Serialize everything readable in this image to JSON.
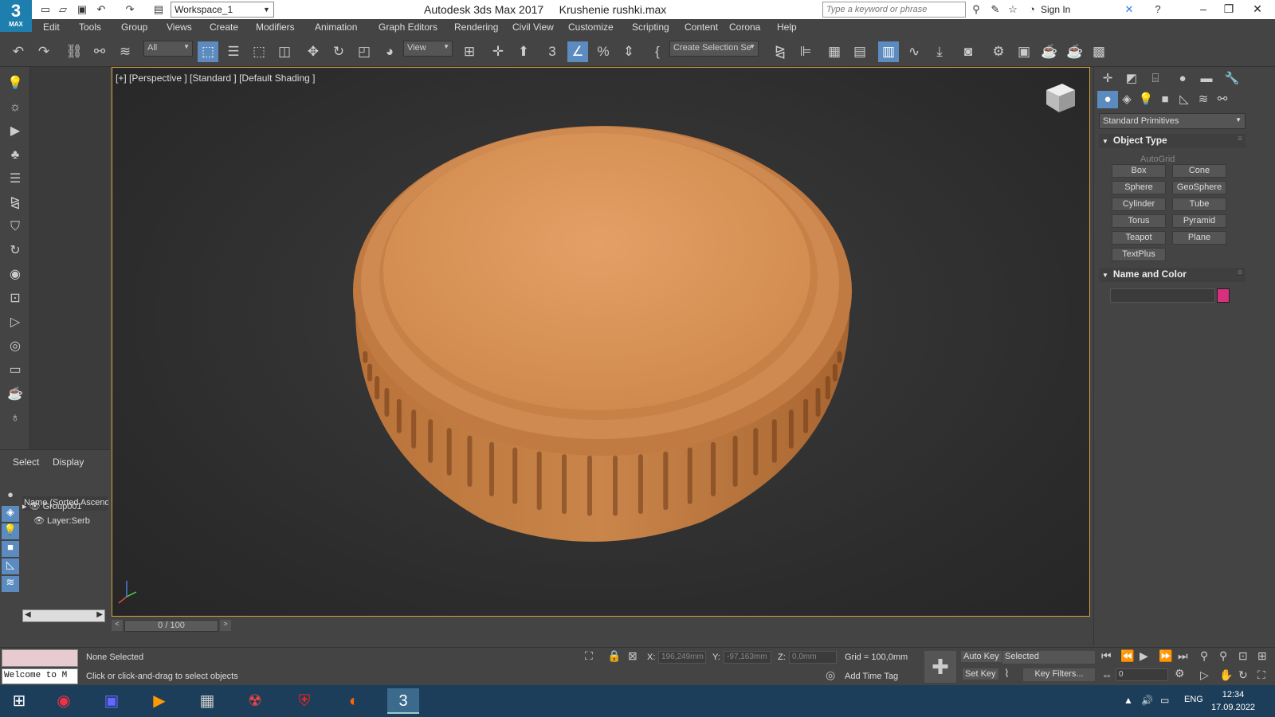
{
  "titlebar": {
    "logo_big": "3",
    "logo_small": "MAX",
    "workspace": "Workspace_1",
    "app_name": "Autodesk 3ds Max 2017",
    "file_name": "Krushenie rushki.max",
    "search_placeholder": "Type a keyword or phrase",
    "sign_in": "Sign In"
  },
  "menu": [
    "Edit",
    "Tools",
    "Group",
    "Views",
    "Create",
    "Modifiers",
    "Animation",
    "Graph Editors",
    "Rendering",
    "Civil View",
    "Customize",
    "Scripting",
    "Content",
    "Corona",
    "Help"
  ],
  "toolbar": {
    "filter": "All",
    "ref_coord": "View",
    "named_sel": "Create Selection Se"
  },
  "viewport": {
    "label": "[+] [Perspective ] [Standard ] [Default Shading ]",
    "object_color": "#d8955a"
  },
  "scene_explorer": {
    "tabs": [
      "Select",
      "Display"
    ],
    "column_header": "Name (Sorted Ascend",
    "rows": [
      "Group001",
      "Layer:Serb"
    ]
  },
  "command_panel": {
    "category": "Standard Primitives",
    "object_type_title": "Object Type",
    "autogrid": "AutoGrid",
    "primitives": [
      "Box",
      "Cone",
      "Sphere",
      "GeoSphere",
      "Cylinder",
      "Tube",
      "Torus",
      "Pyramid",
      "Teapot",
      "Plane",
      "TextPlus"
    ],
    "name_color_title": "Name and Color",
    "swatch_color": "#d6307f"
  },
  "timeline": {
    "frame": "0 / 100"
  },
  "status": {
    "listener": "Welcome to M",
    "selection": "None Selected",
    "prompt": "Click or click-and-drag to select objects",
    "x_label": "X:",
    "x_value": "196,249mm",
    "y_label": "Y:",
    "y_value": "-97,163mm",
    "z_label": "Z:",
    "z_value": "0,0mm",
    "grid": "Grid = 100,0mm",
    "add_time_tag": "Add Time Tag",
    "auto_key": "Auto Key",
    "set_key": "Set Key",
    "key_mode": "Selected",
    "key_filters": "Key Filters...",
    "frame_field": "0"
  },
  "taskbar": {
    "lang": "ENG",
    "time": "12:34",
    "date": "17.09.2022"
  }
}
